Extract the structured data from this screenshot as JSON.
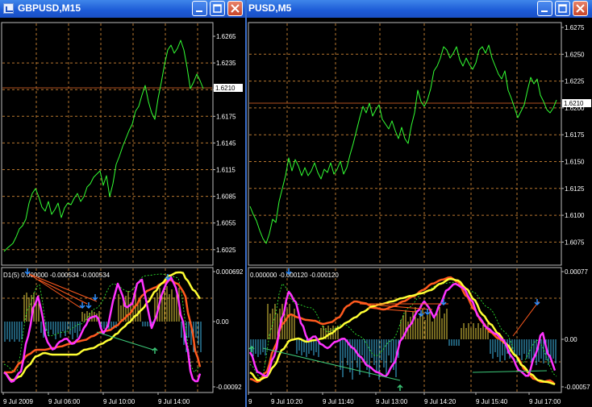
{
  "windows": [
    {
      "title": "GBPUSD,M15",
      "current_price": "1.6210",
      "price_axis": [
        "1.6265",
        "1.6235",
        "1.6205",
        "1.6175",
        "1.6145",
        "1.6115",
        "1.6085",
        "1.6055",
        "1.6025"
      ],
      "indicator_label": "D1(5) 0.000000 -0.000534 -0.000534",
      "indicator_axis": [
        "0.000692",
        "0.00",
        "-0.00092"
      ],
      "time_axis": [
        "9 Jul 2009",
        "9 Jul 06:00",
        "9 Jul 10:00",
        "9 Jul 14:00"
      ]
    },
    {
      "title": "PUSD,M5",
      "current_price": "1.6210",
      "price_axis": [
        "1.6275",
        "1.6250",
        "1.6225",
        "1.6200",
        "1.6175",
        "1.6150",
        "1.6125",
        "1.6100",
        "1.6075"
      ],
      "indicator_label": "0.000000 -0.000120 -0.000120",
      "indicator_axis": [
        "0.00077",
        "0.00",
        "-0.00057"
      ],
      "time_axis": [
        "9",
        "9 Jul 10:20",
        "9 Jul 11:40",
        "9 Jul 13:00",
        "9 Jul 14:20",
        "9 Jul 15:40",
        "9 Jul 17:00"
      ]
    }
  ],
  "colors": {
    "price_line": "#33ff33",
    "grid": "#b8772f",
    "current_price_line": "#b05020",
    "macd_magenta": "#ff33ff",
    "line_yellow": "#ffff33",
    "line_orange": "#ff5a1e",
    "hist_positive": "#e8d040",
    "hist_negative": "#40b8e8",
    "arrow_blue": "#2f8fff",
    "arrow_green": "#3cc878"
  }
}
